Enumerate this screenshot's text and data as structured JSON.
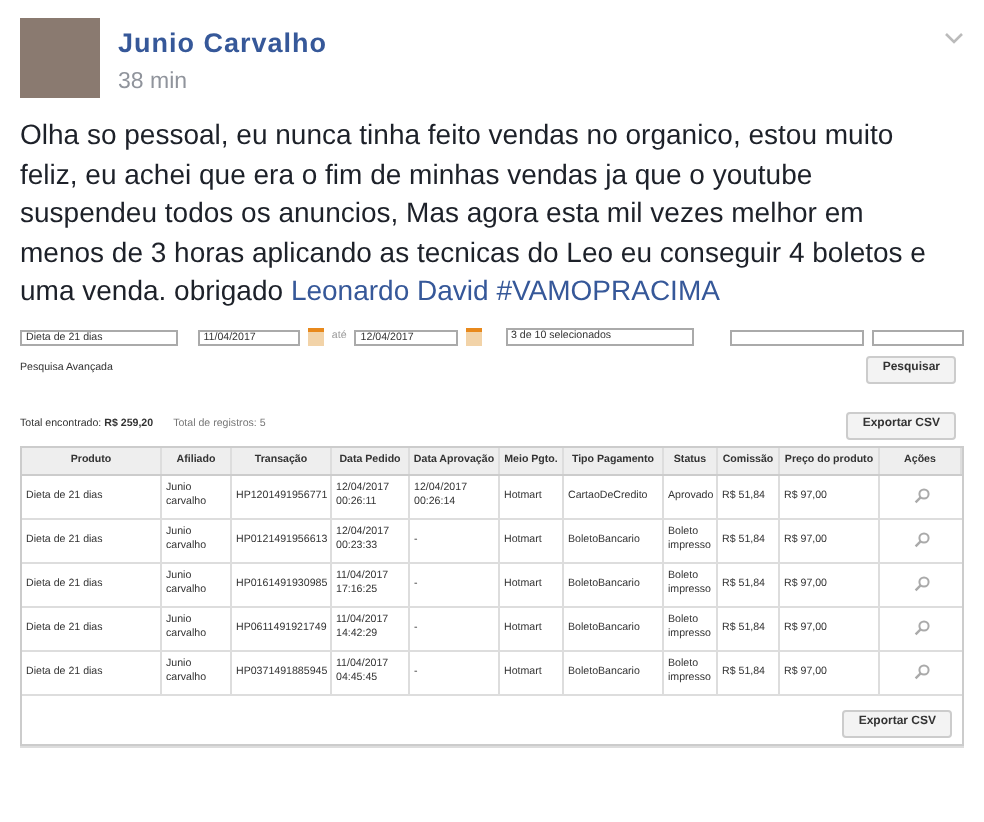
{
  "post": {
    "author": "Junio Carvalho",
    "time": "38 min",
    "text_parts": [
      {
        "kind": "text",
        "text": "Olha so pessoal, eu nunca tinha feito vendas no organico, estou muito feliz, eu achei que era o fim de minhas vendas ja que o youtube suspendeu todos os anuncios, Mas agora esta mil vezes melhor em menos de 3 horas aplicando as tecnicas do Leo eu conseguir 4 boletos e uma venda. obrigado "
      },
      {
        "kind": "link",
        "text": "Leonardo David"
      },
      {
        "kind": "link",
        "text": "#VAMOPRACIMA"
      }
    ]
  },
  "filters": {
    "product": "Dieta de 21 dias",
    "date_from": "11/04/2017",
    "between": "até",
    "date_to": "12/04/2017",
    "status_select": "3 de 10 selecionados",
    "advanced": "Pesquisa Avançada",
    "search_button": "Pesquisar"
  },
  "summary": {
    "total_label": "Total encontrado:",
    "total_value": "R$ 259,20",
    "records": "Total de registros: 5",
    "export_button": "Exportar CSV"
  },
  "table": {
    "columns": [
      "Produto",
      "Afiliado",
      "Transação",
      "Data Pedido",
      "Data Aprovação",
      "Meio Pgto.",
      "Tipo Pagamento",
      "Status",
      "Comissão",
      "Preço do produto",
      "Ações"
    ],
    "rows": [
      [
        "Dieta de 21 dias",
        "Junio carvalho",
        "HP1201491956771",
        "12/04/2017 00:26:11",
        "12/04/2017 00:26:14",
        "Hotmart",
        "CartaoDeCredito",
        "Aprovado",
        "R$ 51,84",
        "R$ 97,00"
      ],
      [
        "Dieta de 21 dias",
        "Junio carvalho",
        "HP0121491956613",
        "12/04/2017 00:23:33",
        "-",
        "Hotmart",
        "BoletoBancario",
        "Boleto impresso",
        "R$ 51,84",
        "R$ 97,00"
      ],
      [
        "Dieta de 21 dias",
        "Junio carvalho",
        "HP0161491930985",
        "11/04/2017 17:16:25",
        "-",
        "Hotmart",
        "BoletoBancario",
        "Boleto impresso",
        "R$ 51,84",
        "R$ 97,00"
      ],
      [
        "Dieta de 21 dias",
        "Junio carvalho",
        "HP0611491921749",
        "11/04/2017 14:42:29",
        "-",
        "Hotmart",
        "BoletoBancario",
        "Boleto impresso",
        "R$ 51,84",
        "R$ 97,00"
      ],
      [
        "Dieta de 21 dias",
        "Junio carvalho",
        "HP0371491885945",
        "11/04/2017 04:45:45",
        "-",
        "Hotmart",
        "BoletoBancario",
        "Boleto impresso",
        "R$ 51,84",
        "R$ 97,00"
      ]
    ]
  },
  "bottom_export_button": "Exportar CSV"
}
